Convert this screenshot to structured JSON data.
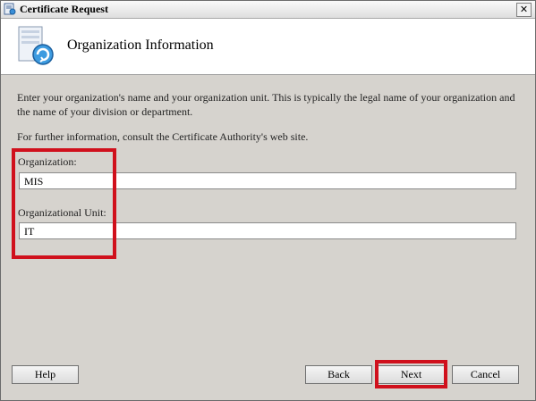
{
  "window": {
    "title": "Certificate Request",
    "close_symbol": "✕"
  },
  "header": {
    "title": "Organization Information"
  },
  "body": {
    "description": "Enter your organization's name and your organization unit. This is typically the legal name of your organization and the name of your division or department.",
    "info": "For further information, consult the Certificate Authority's web site."
  },
  "form": {
    "organization_label": "Organization:",
    "organization_value": "MIS",
    "unit_label": "Organizational Unit:",
    "unit_value": "IT"
  },
  "buttons": {
    "help": "Help",
    "back": "Back",
    "next": "Next",
    "cancel": "Cancel"
  },
  "colors": {
    "highlight": "#d0101c",
    "dialog_bg": "#d6d3ce",
    "header_bg": "#ffffff"
  }
}
